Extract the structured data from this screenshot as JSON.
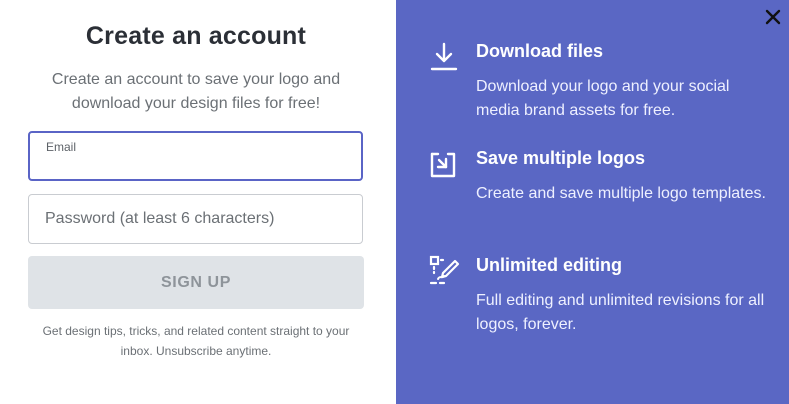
{
  "form": {
    "title": "Create an account",
    "subtitle": "Create an account to save your logo and download your design files for free!",
    "email_label": "Email",
    "email_value": "",
    "password_placeholder": "Password (at least 6 characters)",
    "password_value": "",
    "signup_label": "SIGN UP",
    "disclaimer": "Get design tips, tricks, and related content straight to your inbox. Unsubscribe anytime."
  },
  "panel": {
    "close_icon": "close-icon",
    "accent_color": "#5a67c4",
    "features": [
      {
        "icon": "download-icon",
        "title": "Download files",
        "description": "Download your logo and your social media brand assets for free."
      },
      {
        "icon": "save-logo-icon",
        "title": "Save multiple logos",
        "description": "Create and save multiple logo templates."
      },
      {
        "icon": "edit-tools-icon",
        "title": "Unlimited editing",
        "description": "Full editing and unlimited revisions for all logos, forever."
      }
    ]
  }
}
